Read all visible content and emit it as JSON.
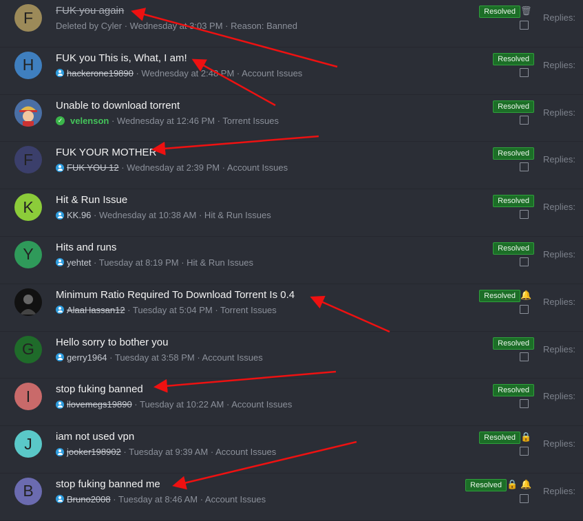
{
  "colors": {
    "background": "#2b2e36",
    "resolved_border": "#2fa13c",
    "resolved_bg": "#1c6e27",
    "arrow": "#ee1111"
  },
  "threads": [
    {
      "avatar_letter": "F",
      "avatar_color": "#9c8a59",
      "title": "FUK you again",
      "deleted": true,
      "meta": "Deleted by Cyler · Wednesday at 3:03 PM · Reason: Banned",
      "status": "Resolved",
      "icons": [
        "trash-icon"
      ],
      "replies_label": "Replies:"
    },
    {
      "avatar_letter": "H",
      "avatar_color": "#3f7fbf",
      "title": "FUK you This is, What, I am!",
      "username": "hackerone19890",
      "user_banned": true,
      "meta": "· Wednesday at 2:48 PM · Account Issues",
      "status": "Resolved",
      "icons": [],
      "replies_label": "Replies:"
    },
    {
      "avatar_letter": "",
      "avatar_color": "#3f5a8a",
      "avatar_image": "cartoon-character-avatar",
      "title": "Unable to download torrent",
      "username": "velenson",
      "user_verified": true,
      "meta": "· Wednesday at 12:46 PM · Torrent Issues",
      "status": "Resolved",
      "icons": [],
      "replies_label": "Replies:"
    },
    {
      "avatar_letter": "F",
      "avatar_color": "#3b3f6b",
      "title": "FUK YOUR MOTHER",
      "username": "FUK YOU 12",
      "user_banned": true,
      "meta": "· Wednesday at 2:39 PM · Account Issues",
      "status": "Resolved",
      "icons": [],
      "replies_label": "Replies:"
    },
    {
      "avatar_letter": "K",
      "avatar_color": "#8ccc3a",
      "title": "Hit & Run Issue",
      "username": "KK.96",
      "meta": "· Wednesday at 10:38 AM · Hit & Run Issues",
      "status": "Resolved",
      "icons": [],
      "replies_label": "Replies:"
    },
    {
      "avatar_letter": "Y",
      "avatar_color": "#2f9a5a",
      "title": "Hits and runs",
      "username": "yehtet",
      "meta": "· Tuesday at 8:19 PM · Hit & Run Issues",
      "status": "Resolved",
      "icons": [],
      "replies_label": "Replies:"
    },
    {
      "avatar_letter": "",
      "avatar_color": "#1a1a1a",
      "avatar_image": "dark-portrait-avatar",
      "title": "Minimum Ratio Required To Download Torrent Is 0.4",
      "username": "AlaaHassan12",
      "user_banned": true,
      "meta": "· Tuesday at 5:04 PM · Torrent Issues",
      "status": "Resolved",
      "icons": [
        "bell-icon"
      ],
      "replies_label": "Replies:"
    },
    {
      "avatar_letter": "G",
      "avatar_color": "#1f6b2a",
      "title": "Hello sorry to bother you",
      "username": "gerry1964",
      "meta": "· Tuesday at 3:58 PM · Account Issues",
      "status": "Resolved",
      "icons": [],
      "replies_label": "Replies:"
    },
    {
      "avatar_letter": "I",
      "avatar_color": "#c96a6a",
      "title": "stop fuking banned",
      "username": "ilovemegs19890",
      "user_banned": true,
      "meta": "· Tuesday at 10:22 AM · Account Issues",
      "status": "Resolved",
      "icons": [],
      "replies_label": "Replies:"
    },
    {
      "avatar_letter": "J",
      "avatar_color": "#5ac8c8",
      "title": "iam not used vpn",
      "username": "jooker198902",
      "user_banned": true,
      "meta": "· Tuesday at 9:39 AM · Account Issues",
      "status": "Resolved",
      "icons": [
        "lock-icon"
      ],
      "replies_label": "Replies:"
    },
    {
      "avatar_letter": "B",
      "avatar_color": "#6b6bb0",
      "title": "stop fuking banned me",
      "username": "Bruno2008",
      "user_banned": true,
      "meta": "· Tuesday at 8:46 AM · Account Issues",
      "status": "Resolved",
      "icons": [
        "lock-icon",
        "bell-icon"
      ],
      "replies_label": "Replies:"
    }
  ]
}
